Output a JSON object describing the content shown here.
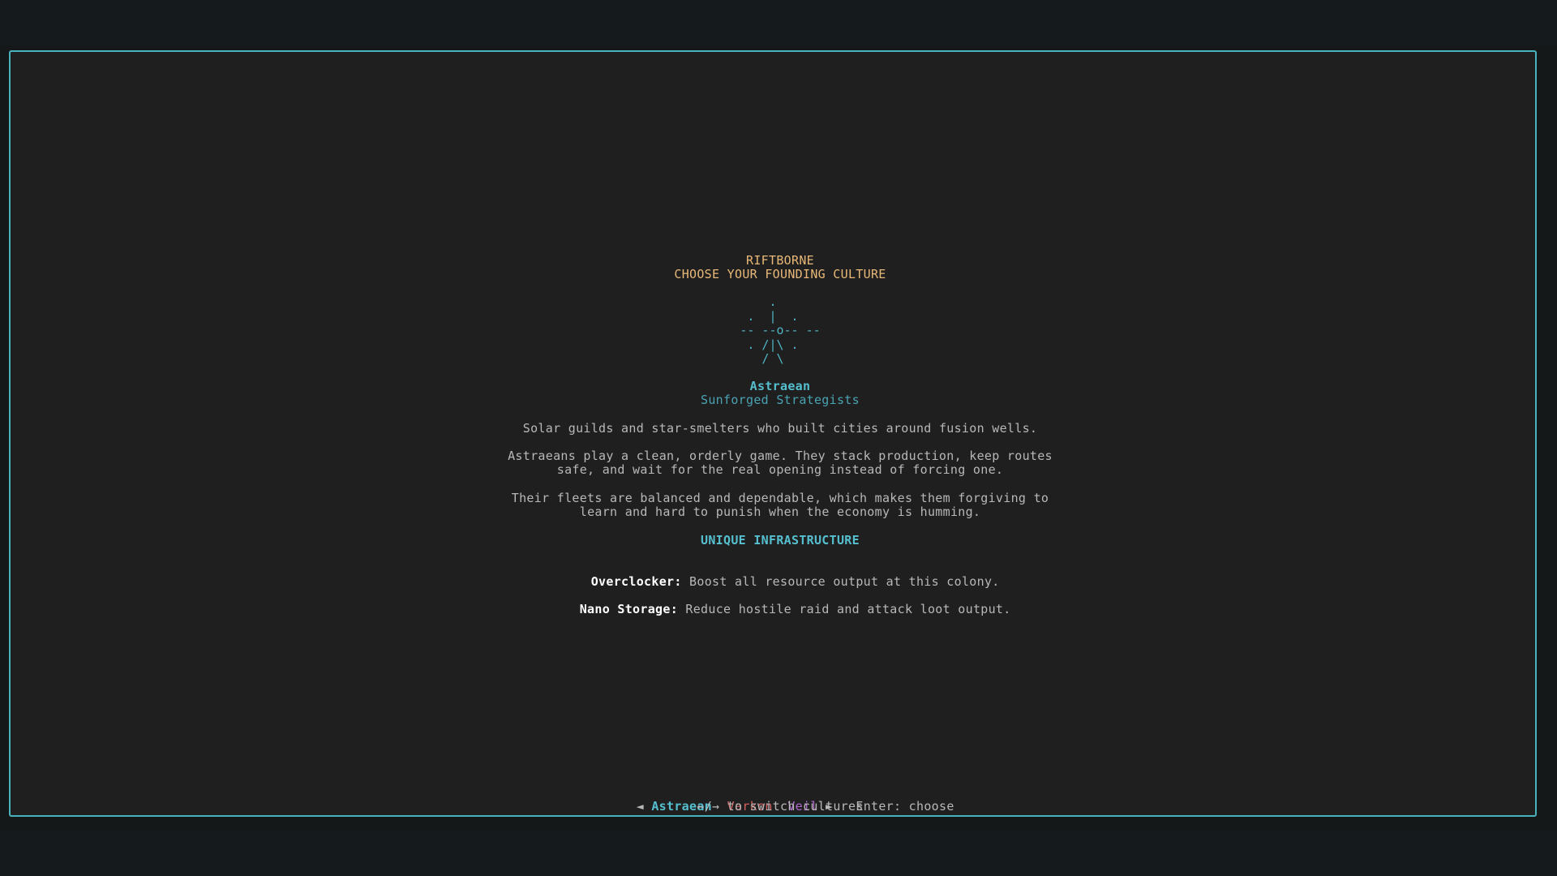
{
  "header": {
    "title": "RIFTBORNE",
    "subtitle": "CHOOSE YOUR FOUNDING CULTURE"
  },
  "emblem": {
    "ascii": "    .\n .  |  .\n-- --o-- --\n . /|\\ .\n   / \\"
  },
  "culture": {
    "name": "Astraean",
    "tagline": "Sunforged Strategists",
    "summary": "Solar guilds and star-smelters who built cities around fusion wells.",
    "play_style_line1": "Astraeans play a clean, orderly game. They stack production, keep routes",
    "play_style_line2": "safe, and wait for the real opening instead of forcing one.",
    "fleet_line1": "Their fleets are balanced and dependable, which makes them forgiving to",
    "fleet_line2": "learn and hard to punish when the economy is humming.",
    "infrastructure_heading": "UNIQUE INFRASTRUCTURE",
    "infrastructure": [
      {
        "name": "Overclocker:",
        "description": "Boost all resource output at this colony."
      },
      {
        "name": "Nano Storage:",
        "description": "Reduce hostile raid and attack loot output."
      }
    ]
  },
  "selector": {
    "left_arrow": "◄",
    "right_arrow": "►",
    "options": [
      {
        "label": "Astraean",
        "color": "#56bfcf",
        "selected": true
      },
      {
        "label": "Varkon",
        "color": "#d46060",
        "selected": false
      },
      {
        "label": "Veil",
        "color": "#b06ad0",
        "selected": false
      }
    ],
    "enter_hint": "Enter: choose",
    "switch_hint": "←/→ to switch cultures"
  },
  "colors": {
    "frame_border": "#49b3bd",
    "title": "#e8b878",
    "accent": "#4fb4c4"
  }
}
